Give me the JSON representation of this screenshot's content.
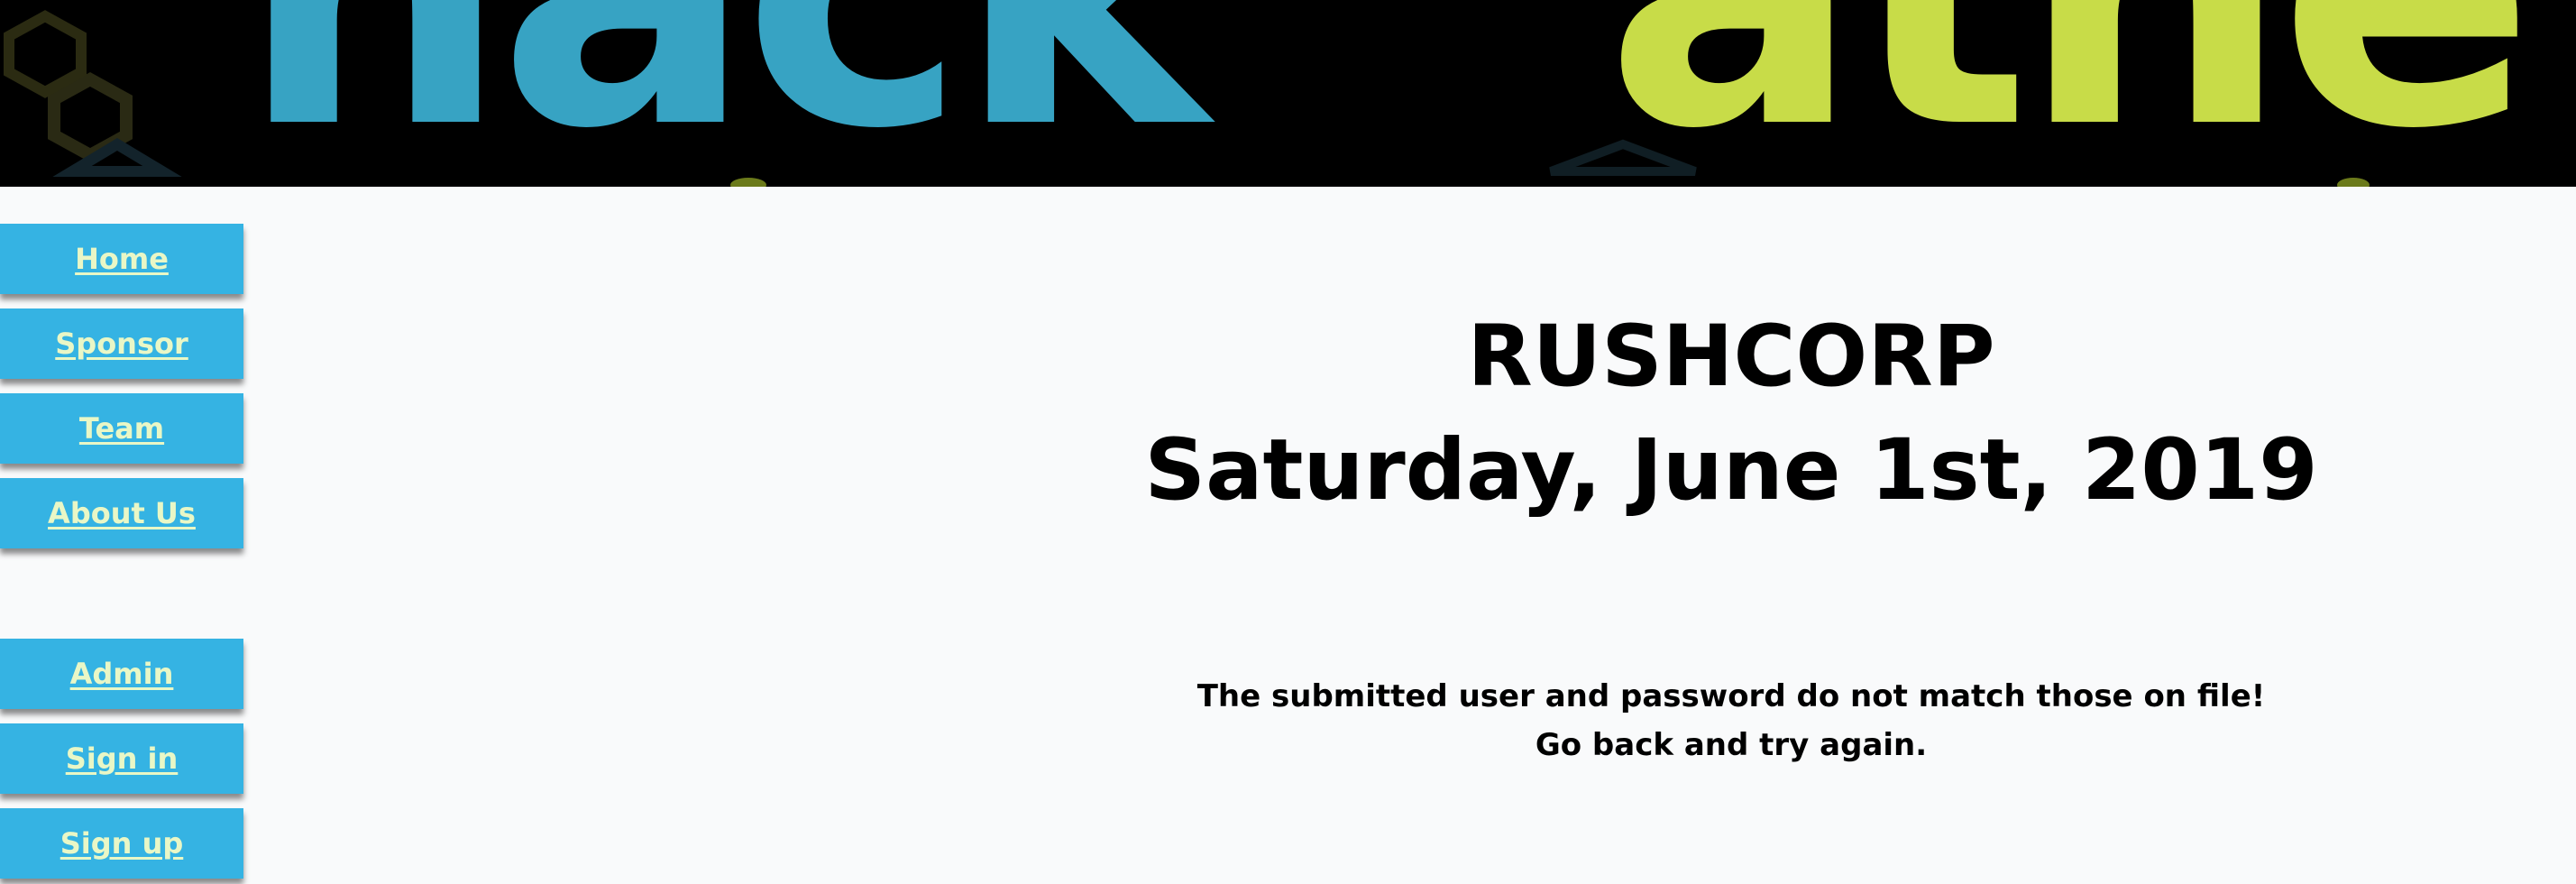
{
  "banner": {
    "text_left": "hack",
    "text_right": "athe",
    "colors": {
      "left": "#37a3c3",
      "right": "#c8dc48",
      "background": "#000000"
    }
  },
  "sidebar": {
    "items": [
      {
        "label": "Home"
      },
      {
        "label": "Sponsor"
      },
      {
        "label": "Team"
      },
      {
        "label": "About Us"
      },
      {
        "label": "Admin"
      },
      {
        "label": "Sign in"
      },
      {
        "label": "Sign up"
      }
    ]
  },
  "main": {
    "title": "RUSHCORP",
    "date": "Saturday, June 1st, 2019",
    "error_line1": "The submitted user and password do not match those on file!",
    "error_line2": "Go back and try again."
  },
  "colors": {
    "nav_bg": "#35b3e3",
    "nav_text": "#e9f7c6",
    "page_bg": "#f9fafb"
  }
}
